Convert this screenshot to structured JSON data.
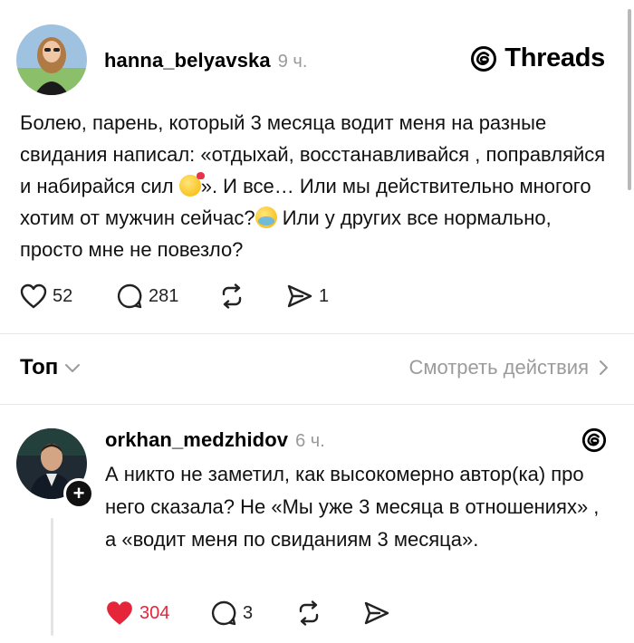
{
  "brand": {
    "name": "Threads",
    "icon": "threads-logo-icon"
  },
  "post": {
    "username": "hanna_belyavska",
    "time": "9 ч.",
    "text_1": "Болею, парень, который 3 месяца водит меня на разные свидания написал: «отдыхай, восстанавливайся , поправляйся и набирайся сил ",
    "emoji_1": "kissing-face-emoji",
    "text_2": "». И все… Или мы действительно многого хотим от мужчин сейчас?",
    "emoji_2": "crying-face-emoji",
    "text_3": " Или у других все нормально, просто мне не повезло?",
    "likes": "52",
    "comments": "281",
    "shares": "1"
  },
  "sort": {
    "label": "Топ",
    "view_actions": "Смотреть действия"
  },
  "reply": {
    "username": "orkhan_medzhidov",
    "time": "6 ч.",
    "text": "А никто не заметил, как высокомерно автор(ка) про него сказала? Не «Мы уже 3 месяца в отношениях» , а «водит меня по свиданиям 3 месяца».",
    "likes": "304",
    "comments": "3",
    "liked": true,
    "like_color": "#e5253a"
  }
}
